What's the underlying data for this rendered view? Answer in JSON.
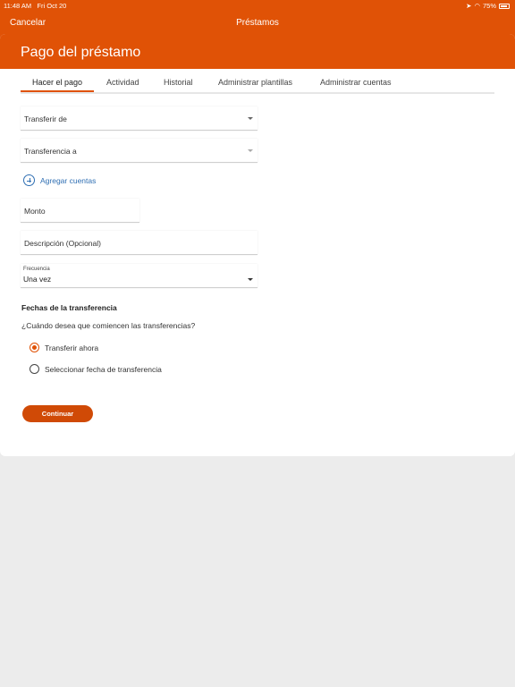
{
  "status_bar": {
    "time": "11:48 AM",
    "date": "Fri Oct 20",
    "battery": "75%"
  },
  "nav": {
    "cancel_label": "Cancelar",
    "title": "Préstamos"
  },
  "page": {
    "title": "Pago del préstamo"
  },
  "tabs": [
    {
      "label": "Hacer el pago",
      "active": true
    },
    {
      "label": "Actividad",
      "active": false
    },
    {
      "label": "Historial",
      "active": false
    },
    {
      "label": "Administrar plantillas",
      "active": false
    },
    {
      "label": "Administrar cuentas",
      "active": false
    }
  ],
  "form": {
    "transfer_from": "Transferir de",
    "transfer_to": "Transferencia a",
    "add_accounts": "Agregar cuentas",
    "amount_placeholder": "Monto",
    "description_placeholder": "Descripción (Opcional)",
    "frequency_label": "Frecuencia",
    "frequency_value": "Una vez",
    "dates_title": "Fechas de la transferencia",
    "dates_question": "¿Cuándo desea que comiencen las transferencias?",
    "option_now": "Transferir ahora",
    "option_date": "Seleccionar fecha de transferencia",
    "selected_option": "Transferir ahora",
    "continue_label": "Continuar"
  },
  "colors": {
    "brand": "#e05206",
    "link": "#2f6fb3",
    "background": "#ececec"
  }
}
